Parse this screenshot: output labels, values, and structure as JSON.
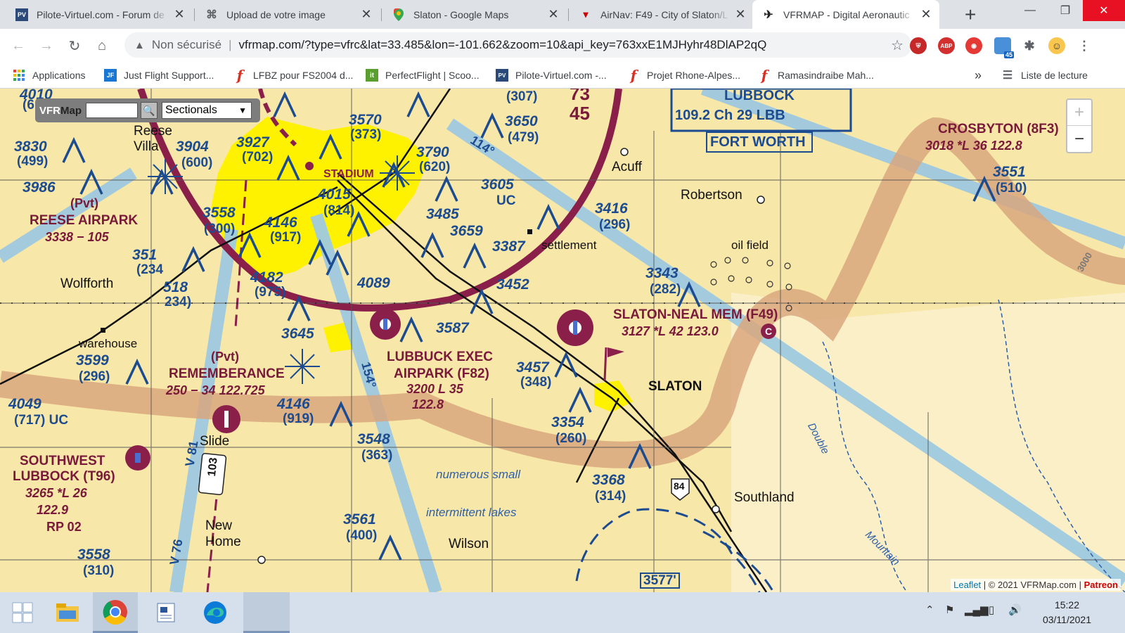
{
  "tabs": [
    {
      "title": "Pilote-Virtuel.com - Forum de",
      "favicon": "PV"
    },
    {
      "title": "Upload de votre image",
      "favicon": "upload-icon"
    },
    {
      "title": "Slaton - Google Maps",
      "favicon": "maps-pin-icon"
    },
    {
      "title": "AirNav: F49 - City of Slaton/L",
      "favicon": "airnav-icon"
    },
    {
      "title": "VFRMAP - Digital Aeronautic",
      "favicon": "plane-icon"
    }
  ],
  "new_tab": "+",
  "address": {
    "security": "Non sécurisé",
    "url": "vfrmap.com/?type=vfrc&lat=33.485&lon=-101.662&zoom=10&api_key=763xxE1MJHyhr48DlAP2qQ"
  },
  "extensions": {
    "abp": "ABP",
    "badge": "45"
  },
  "bookmarks": [
    {
      "label": "Applications",
      "icon": "apps-grid-icon"
    },
    {
      "label": "Just Flight Support...",
      "icon": "JF"
    },
    {
      "label": "LFBZ pour FS2004 d...",
      "icon": "f"
    },
    {
      "label": "PerfectFlight | Scoo...",
      "icon": "it"
    },
    {
      "label": "Pilote-Virtuel.com -...",
      "icon": "PV"
    },
    {
      "label": "Projet Rhone-Alpes...",
      "icon": "f"
    },
    {
      "label": "Ramasindraibe Mah...",
      "icon": "f"
    }
  ],
  "bookmarks_more": "»",
  "reading_list": "Liste de lecture",
  "vfrmap": {
    "logo_vfr": "VFR",
    "logo_map": "Map",
    "search_value": "",
    "chart_type": "Sectionals"
  },
  "zoom": {
    "in": "+",
    "out": "−"
  },
  "attribution": {
    "leaflet": "Leaflet",
    "copy": "| © 2021 VFRMap.com |",
    "patreon": "Patreon"
  },
  "map_labels": {
    "top_left_elev": "4010",
    "top_left_paren": "(6",
    "e_307": "(307)",
    "sector_73": "73",
    "sector_45": "45",
    "lubbock": "LUBBOCK",
    "vor": "109.2 Ch 29 LBB",
    "fort_worth": "FORT WORTH",
    "crosbyton": "CROSBYTON (8F3)",
    "crosbyton_info": "3018 *L 36 122.8",
    "e3551": "3551",
    "e3551p": "(510)",
    "e3830": "3830",
    "e3830p": "(499)",
    "reese_villa": "Reese Villa",
    "e3904": "3904",
    "e3904p": "(600)",
    "e3927": "3927",
    "e3927p": "(702)",
    "e3570": "3570",
    "e3570p": "(373)",
    "e3650": "3650",
    "e3650p": "(479)",
    "e3790": "3790",
    "e3790p": "(620)",
    "course_114": "114°",
    "acuff": "Acuff",
    "robertson": "Robertson",
    "e3986": "3986",
    "stadium": "STADIUM",
    "e4015": "4015",
    "e4015p": "(814)",
    "e3605": "3605",
    "e3605p": "UC",
    "pvt1": "(Pvt)",
    "reese_airpark": "REESE AIRPARK",
    "reese_info": "3338 − 105",
    "e3558a": "3558",
    "e3558ap": "(300)",
    "e4146a": "4146",
    "e4146ap": "(917)",
    "e3485": "3485",
    "e3416": "3416",
    "e3416p": "(296)",
    "e3659": "3659",
    "e3387": "3387",
    "settlement": "settlement",
    "oil_field": "oil field",
    "e351": "351",
    "e351p": "(234",
    "wolfforth": "Wolfforth",
    "e4182": "4182",
    "e4182p": "(975)",
    "e4089": "4089",
    "e3343": "3343",
    "e3343p": "(282)",
    "e3452": "3452",
    "e518": "518",
    "e518p": "234)",
    "slaton_neal": "SLATON-NEAL MEM (F49)",
    "slaton_neal_info": "3127 *L 42 123.0",
    "warehouse": "warehouse",
    "e3645": "3645",
    "e3587": "3587",
    "e3599": "3599",
    "e3599p": "(296)",
    "pvt2": "(Pvt)",
    "rememberance": "REMEMBERANCE",
    "rememberance_info": "250 − 34 122.725",
    "lubbock_exec": "LUBBUCK EXEC",
    "airpark_f82": "AIRPARK (F82)",
    "f82_info": "3200 L 35",
    "f82_freq": "122.8",
    "e3457": "3457",
    "e3457p": "(348)",
    "slaton": "SLATON",
    "course_154": "154°",
    "e4049": "4049",
    "e4049p": "(717) UC",
    "e4146b": "4146",
    "e4146bp": "(919)",
    "e3354": "3354",
    "e3354p": "(260)",
    "slide": "Slide",
    "e3548": "3548",
    "e3548p": "(363)",
    "southwest": "SOUTHWEST",
    "lubbock_t96": "LUBBOCK (T96)",
    "t96_info": "3265 *L 26",
    "t96_freq": "122.9",
    "rp02": "RP 02",
    "v81": "V 81",
    "r103": "103",
    "numerous_small": "numerous small",
    "e3368": "3368",
    "e3368p": "(314)",
    "southland": "Southland",
    "r84": "84",
    "double": "Double",
    "intermittent": "intermittent lakes",
    "new_home": "New Home",
    "e3561": "3561",
    "e3561p": "(400)",
    "wilson": "Wilson",
    "e3558b": "3558",
    "e3558bp": "(310)",
    "v76": "V 76",
    "mountain": "Mountain",
    "e3577": "3577'",
    "c_label": "C",
    "r3000": "3000"
  },
  "taskbar": {
    "time": "15:22",
    "date": "03/11/2021"
  },
  "colors": {
    "map_bg": "#f7e7a8",
    "city_yellow": "#fff200",
    "class_c": "#8a1f4a",
    "airway": "#9ec9df",
    "moa_band": "#d9a77e",
    "elevation_blue": "#1c4b8f"
  }
}
